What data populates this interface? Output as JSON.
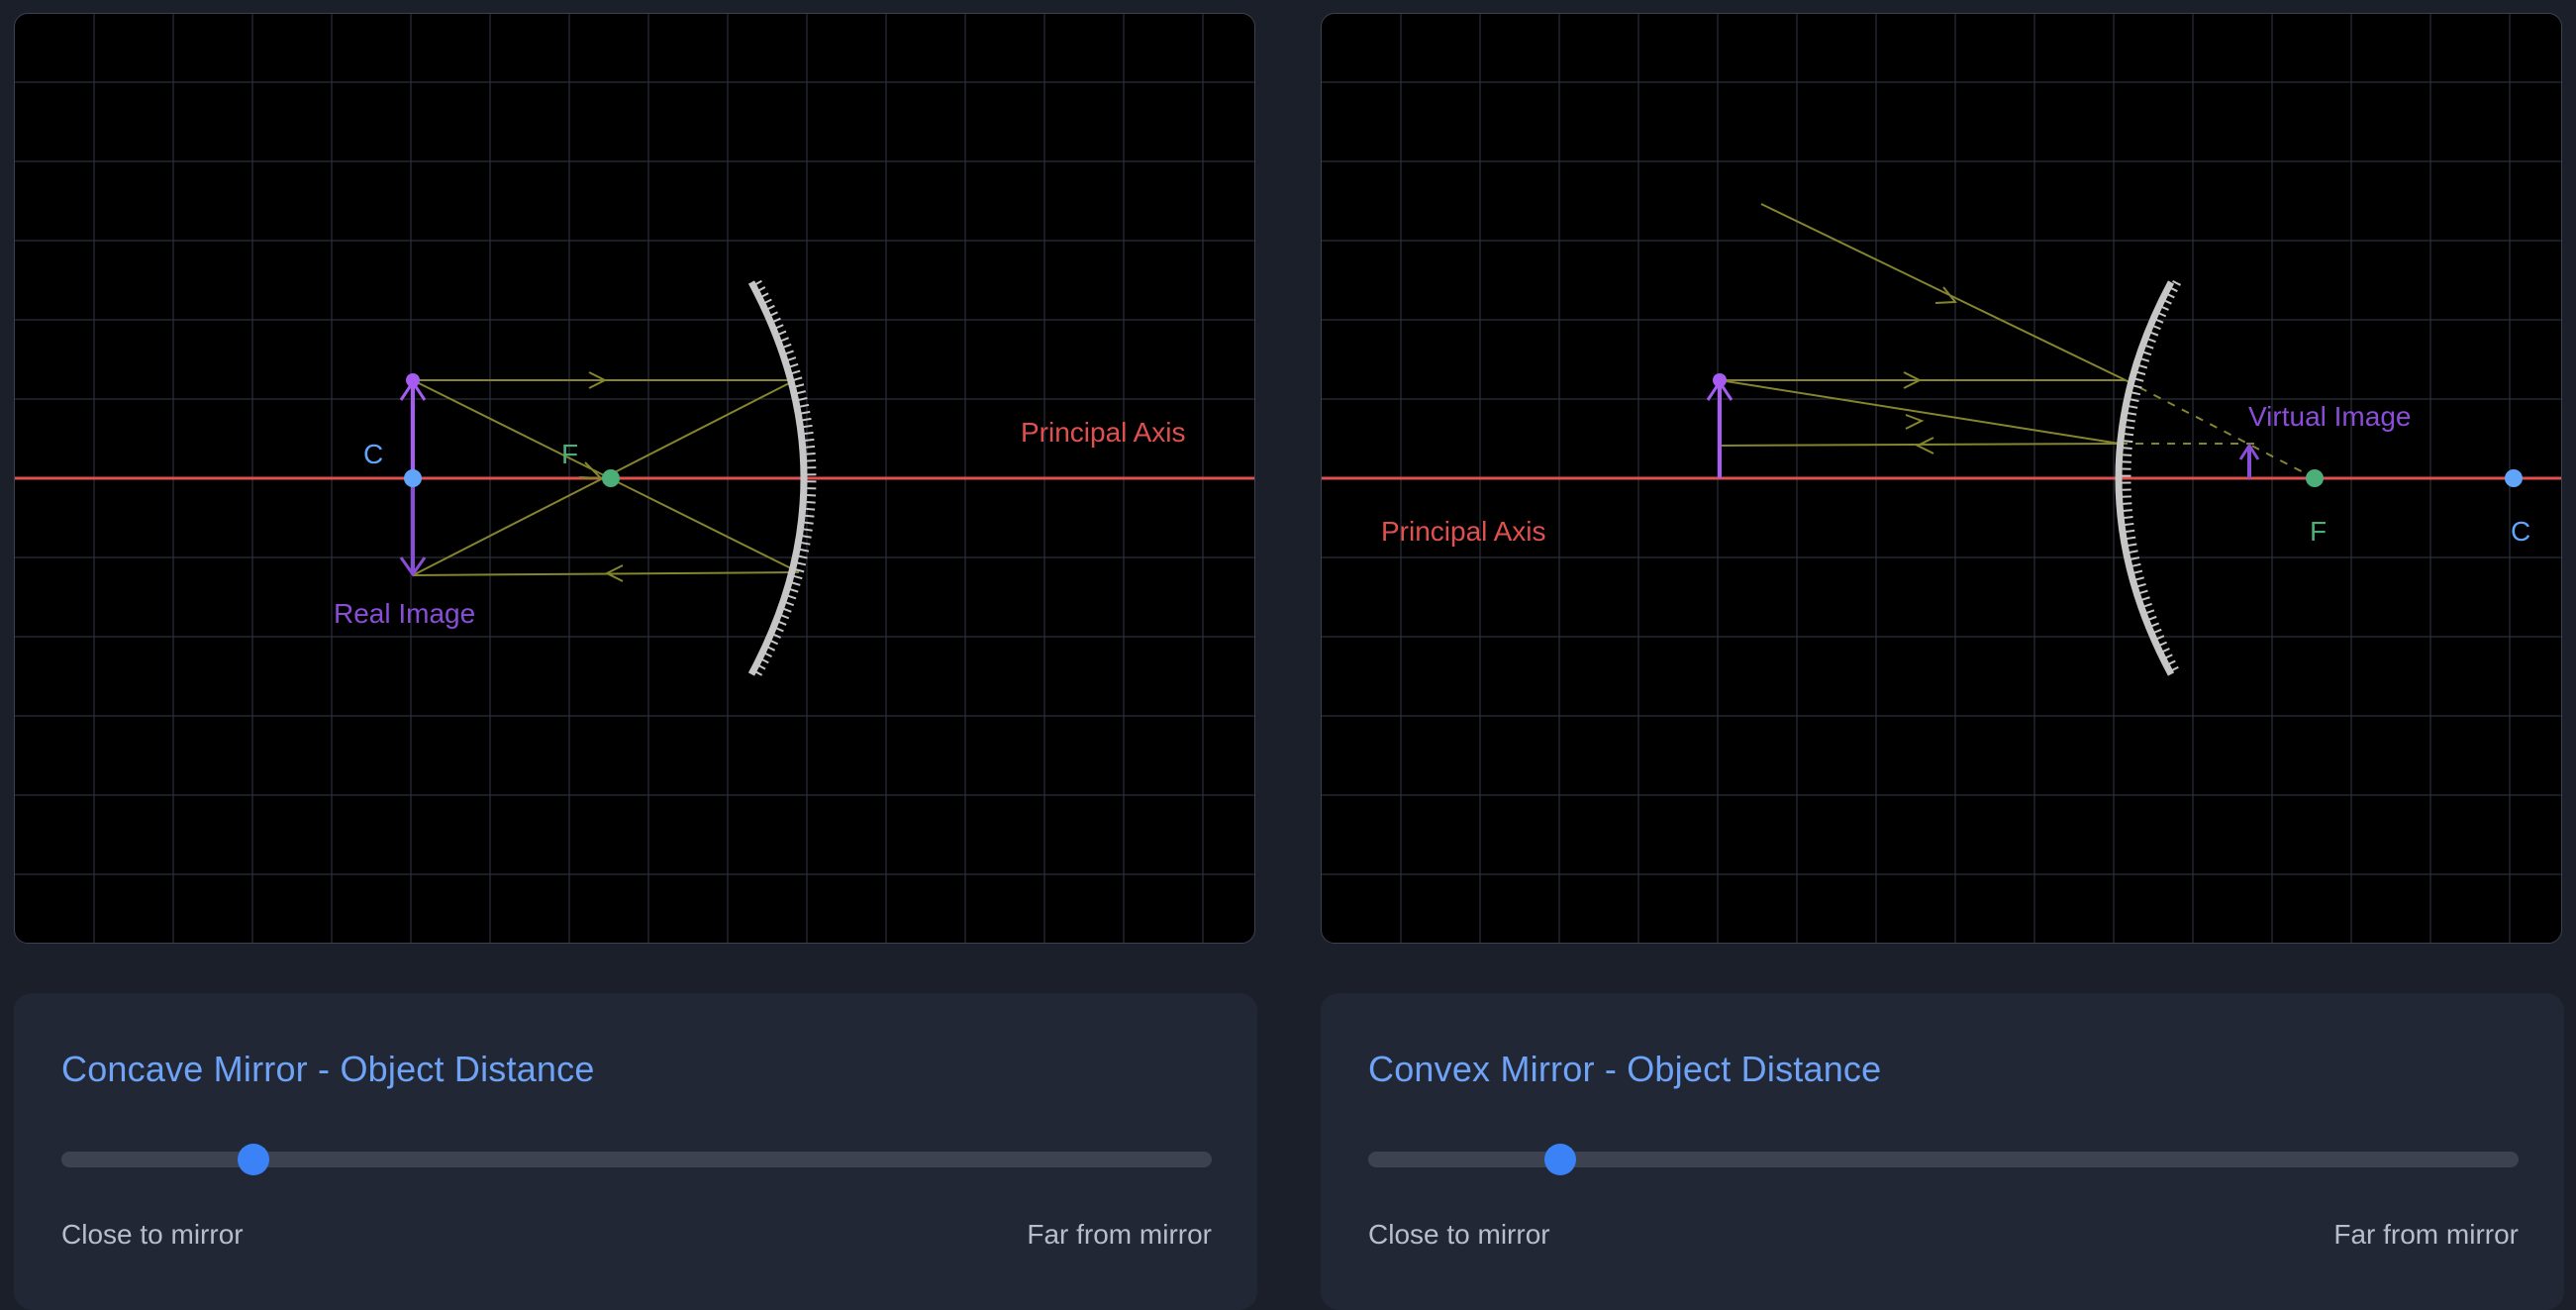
{
  "colors": {
    "principal_axis": "#e0504f",
    "ray": "#85852f",
    "object": "#a65cf0",
    "image": "#8a4dd8",
    "center_point": "#60a5fa",
    "focal_point": "#4caf7a",
    "mirror": "#c6c6c6",
    "title": "#6ea3f7",
    "slider_thumb": "#3b82f6"
  },
  "concave": {
    "labels": {
      "center": "C",
      "focal": "F",
      "axis": "Principal Axis",
      "image": "Real Image"
    },
    "panel": {
      "title": "Concave Mirror - Object Distance",
      "slider_value": 0.167,
      "min_label": "Close to mirror",
      "max_label": "Far from mirror"
    }
  },
  "convex": {
    "labels": {
      "center": "C",
      "focal": "F",
      "axis": "Principal Axis",
      "image": "Virtual Image"
    },
    "panel": {
      "title": "Convex Mirror - Object Distance",
      "slider_value": 0.167,
      "min_label": "Close to mirror",
      "max_label": "Far from mirror"
    }
  }
}
